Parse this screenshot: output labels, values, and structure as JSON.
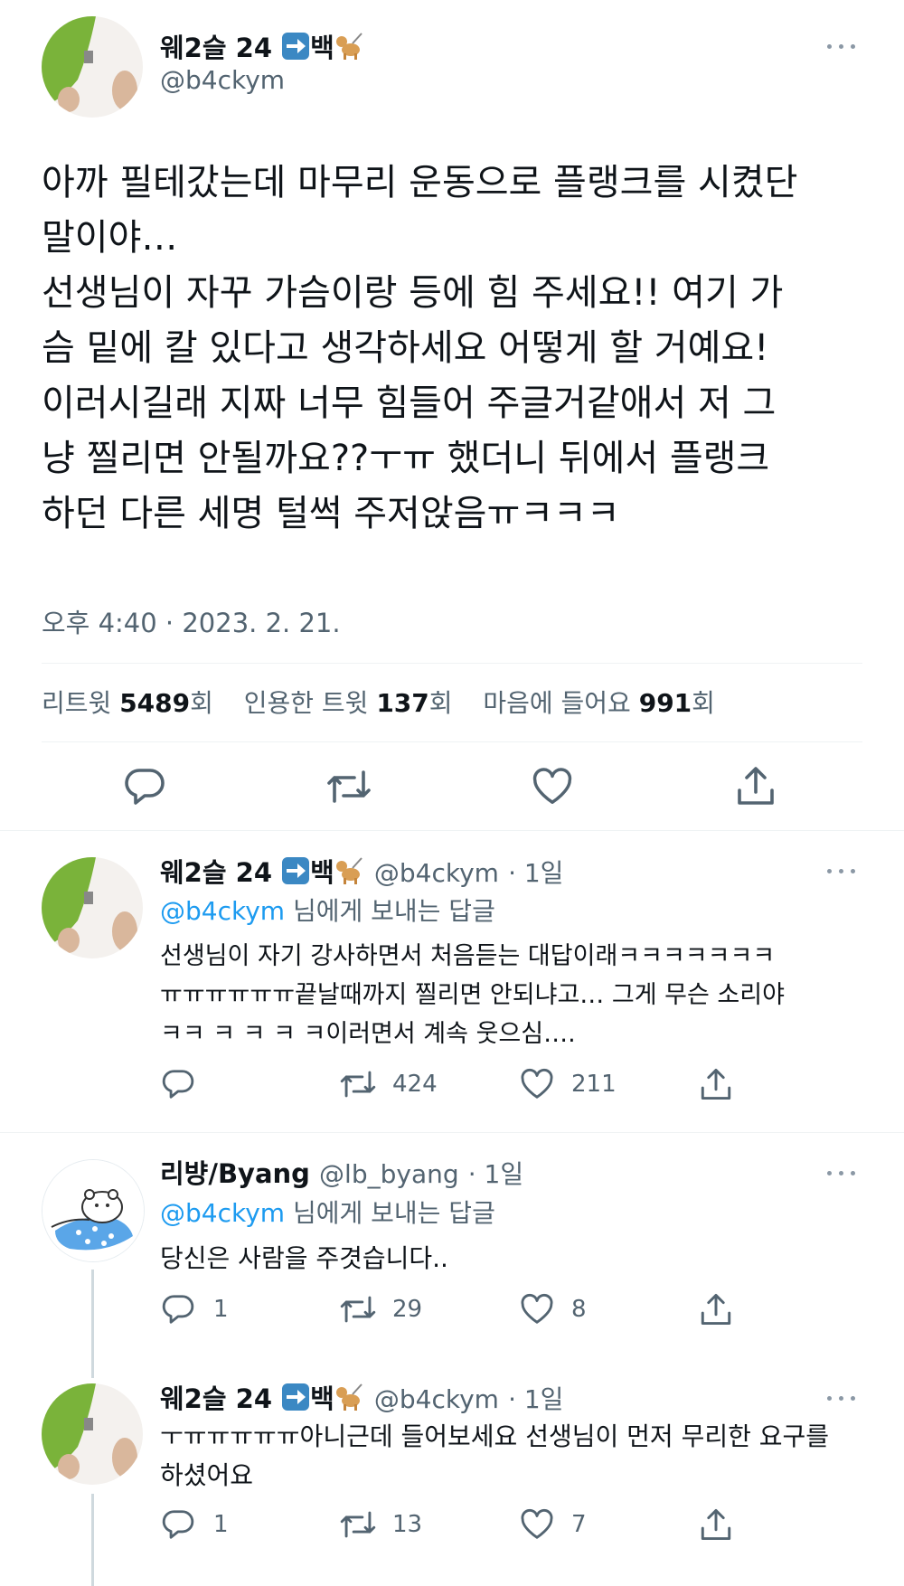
{
  "main_tweet": {
    "display_name": "웨2슬 24",
    "handle": "@b4ckym",
    "text": "아까 필테갔는데 마무리 운동으로 플랭크를 시켰단\n말이야…\n선생님이 자꾸 가슴이랑 등에 힘 주세요!! 여기 가\n슴 밑에 칼 있다고 생각하세요 어떻게 할 거예요!\n이러시길래 지짜 너무 힘들어 주글거같애서 저 그\n냥 찔리면 안될까요??ㅜㅠ 했더니 뒤에서 플랭크\n하던 다른 세명 털썩 주저앉음ㅠㅋㅋㅋ",
    "timestamp": "오후 4:40 · 2023. 2. 21.",
    "stats": {
      "retweets_label": "리트윗",
      "retweets_value": "5489",
      "retweets_suffix": "회",
      "quotes_label": "인용한 트윗",
      "quotes_value": "137",
      "quotes_suffix": "회",
      "likes_label": "마음에 들어요",
      "likes_value": "991",
      "likes_suffix": "회"
    }
  },
  "replies": [
    {
      "display_name": "웨2슬 24",
      "handle": "@b4ckym",
      "time": "· 1일",
      "reply_to_handle": "@b4ckym",
      "reply_to_suffix": " 님에게 보내는 답글",
      "text": "선생님이 자기 강사하면서 처음듣는 대답이래ㅋㅋㅋㅋㅋㅋㅋ\nㅠㅠㅠㅠㅠㅠ끝날때까지 찔리면 안되냐고… 그게 무슨 소리야\nㅋㅋ ㅋ ㅋ ㅋ ㅋ이러면서 계속 웃으심….",
      "reply_count": "",
      "retweet_count": "424",
      "like_count": "211"
    },
    {
      "display_name": "리뱡/Byang",
      "handle": "@lb_byang",
      "time": "· 1일",
      "reply_to_handle": "@b4ckym",
      "reply_to_suffix": " 님에게 보내는 답글",
      "text": "당신은 사람을 주겻습니다..",
      "reply_count": "1",
      "retweet_count": "29",
      "like_count": "8"
    },
    {
      "display_name": "웨2슬 24",
      "handle": "@b4ckym",
      "time": "· 1일",
      "text": "ㅜㅠㅠㅠㅠㅠ아니근데 들어보세요 선생님이 먼저 무리한 요구를\n하셨어요",
      "reply_count": "1",
      "retweet_count": "13",
      "like_count": "7"
    }
  ],
  "icons": {
    "reply": "reply-icon",
    "retweet": "retweet-icon",
    "like": "heart-icon",
    "share": "share-icon",
    "more": "more-icon",
    "arrow_emoji": "arrow-right-emoji",
    "dog_emoji": "guide-dog-emoji"
  },
  "colors": {
    "text": "#0f1419",
    "secondary": "#536471",
    "link": "#1d9bf0",
    "divider": "#eff3f4"
  }
}
